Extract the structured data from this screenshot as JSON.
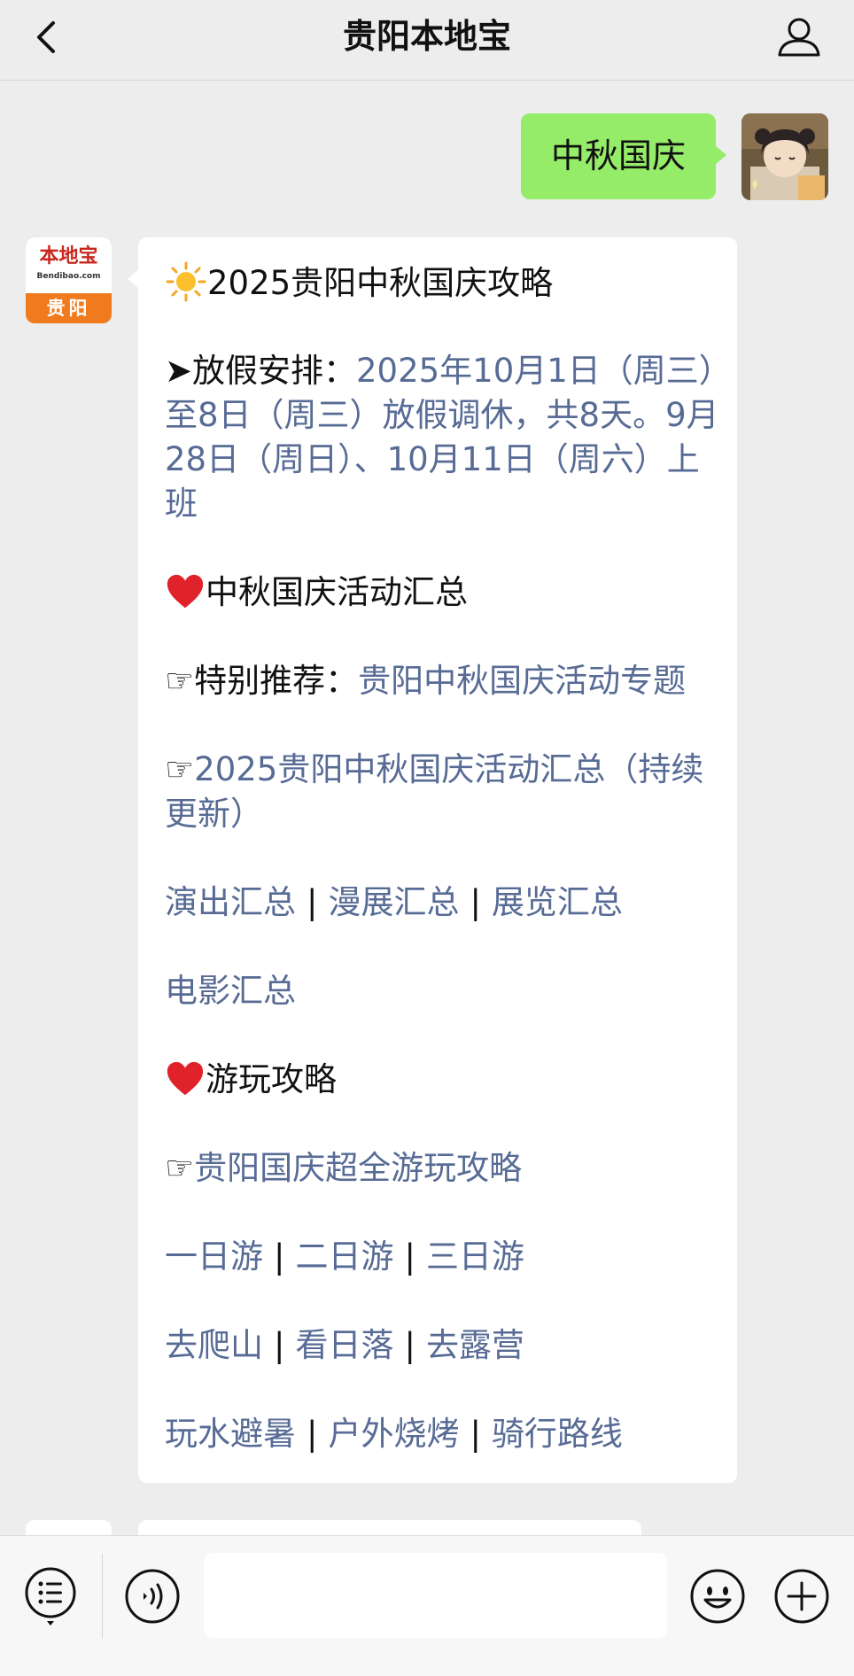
{
  "header": {
    "title": "贵阳本地宝"
  },
  "sent_message": {
    "text": "中秋国庆"
  },
  "bot_avatar": {
    "logo_text": "本地宝",
    "logo_url": "Bendibao.com",
    "city": "贵阳"
  },
  "message": {
    "title": "2025贵阳中秋国庆攻略",
    "holiday_label": "➤放假安排：",
    "holiday_text": "2025年10月1日（周三）至8日（周三）放假调休，共8天。9月28日（周日）、10月11日（周六）上班",
    "section1_title": "中秋国庆活动汇总",
    "special_label": "☞特别推荐：",
    "special_link": "贵阳中秋国庆活动专题",
    "summary_prefix": "☞",
    "summary_link": "2025贵阳中秋国庆活动汇总（持续更新）",
    "row1": [
      "演出汇总",
      "漫展汇总",
      "展览汇总"
    ],
    "row2": [
      "电影汇总"
    ],
    "section2_title": "游玩攻略",
    "guide_prefix": "☞",
    "guide_link": "贵阳国庆超全游玩攻略",
    "row3": [
      "一日游",
      "二日游",
      "三日游"
    ],
    "row4": [
      "去爬山",
      "看日落",
      "去露营"
    ],
    "row5": [
      "玩水避暑",
      "户外烧烤",
      "骑行路线"
    ],
    "separator": "|"
  },
  "icons": {
    "back": "chevron-left-icon",
    "profile": "person-icon",
    "sun": "sun-icon",
    "heart": "heart-icon",
    "menu": "list-menu-icon",
    "voice": "voice-icon",
    "emoji": "smile-icon",
    "plus": "plus-icon"
  },
  "colors": {
    "sent_bubble": "#95ec69",
    "link": "#576b95",
    "background": "#ededed",
    "avatar_orange": "#f07a1e",
    "heart_red": "#e0222b"
  }
}
